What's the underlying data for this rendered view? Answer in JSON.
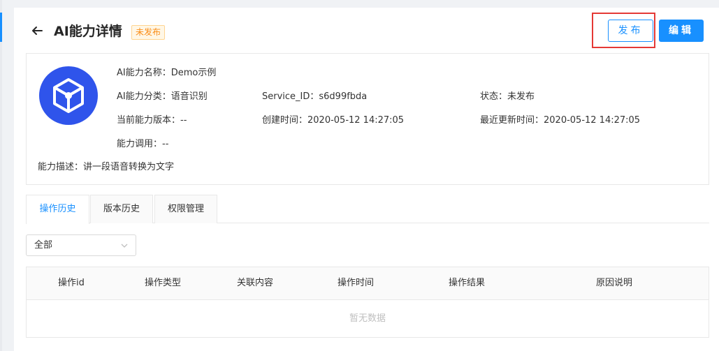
{
  "page": {
    "title": "AI能力详情",
    "status_badge": "未发布",
    "publish_button": "发布",
    "edit_button": "编辑"
  },
  "info": {
    "name": "AI能力名称：Demo示例",
    "category": "AI能力分类：语音识别",
    "service_id": "Service_ID：s6d99fbda",
    "status": "状态：未发布",
    "current_version": "当前能力版本：--",
    "created": "创建时间：2020-05-12 14:27:05",
    "updated": "最近更新时间：2020-05-12 14:27:05",
    "calls": "能力调用：--",
    "description": "能力描述：讲一段语音转换为文字"
  },
  "tabs": [
    {
      "label": "操作历史"
    },
    {
      "label": "版本历史"
    },
    {
      "label": "权限管理"
    }
  ],
  "filter": {
    "selected": "全部"
  },
  "table": {
    "columns": [
      "操作id",
      "操作类型",
      "关联内容",
      "操作时间",
      "操作结果",
      "原因说明"
    ],
    "empty_text": "暂无数据"
  },
  "colors": {
    "primary": "#1890ff",
    "badge_text": "#fa8c16",
    "highlight_border": "#e53935",
    "icon_bg": "#2f54eb"
  },
  "icons": {
    "back": "arrow-left-icon",
    "ai": "cube-icon",
    "select": "chevron-down-icon"
  }
}
